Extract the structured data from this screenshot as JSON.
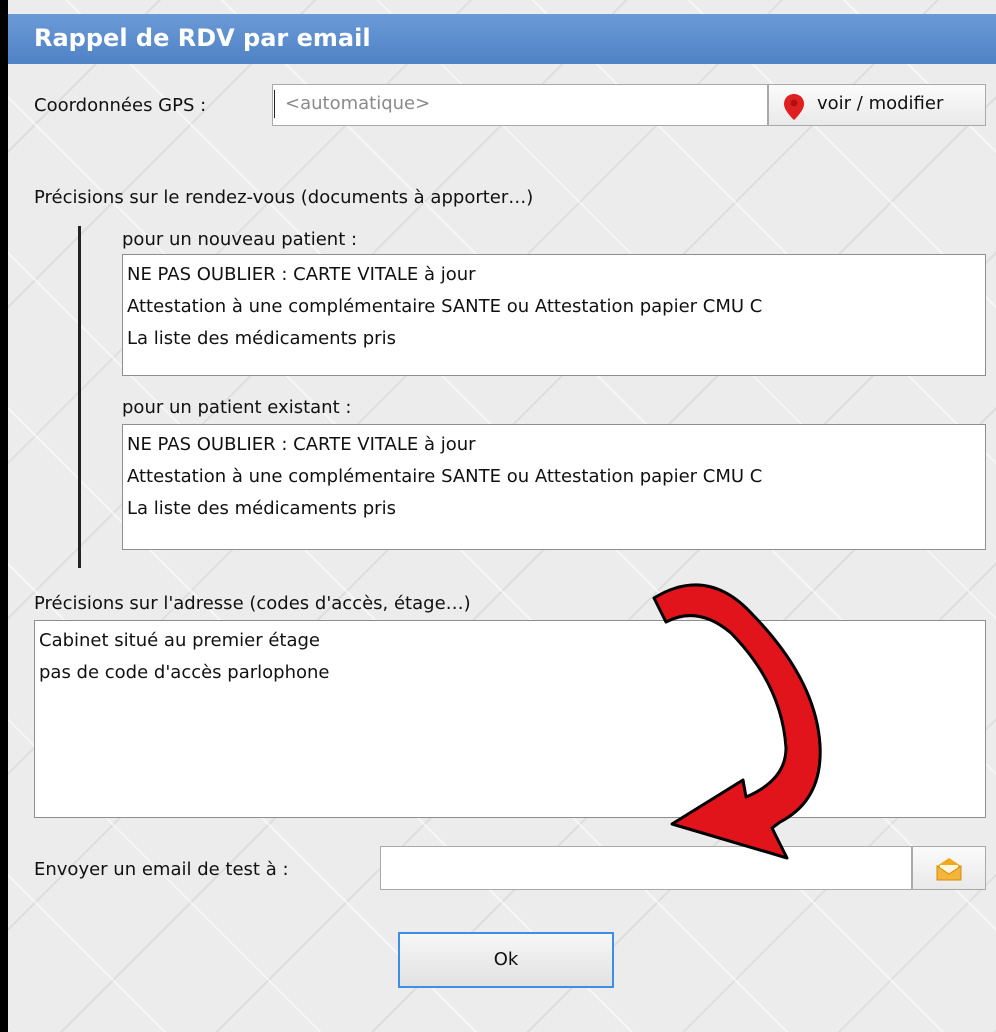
{
  "window": {
    "title": "Rappel de RDV par email"
  },
  "gps": {
    "label": "Coordonnées GPS :",
    "value": "<automatique>",
    "button_label": "voir / modifier"
  },
  "appointment": {
    "heading": "Précisions sur le rendez-vous (documents à apporter…)",
    "new_patient": {
      "label": "pour un nouveau patient :",
      "lines": [
        "NE PAS OUBLIER : CARTE VITALE à jour",
        "Attestation à une complémentaire SANTE ou Attestation papier CMU C",
        "La liste des médicaments pris"
      ]
    },
    "existing_patient": {
      "label": "pour un patient existant :",
      "lines": [
        "NE PAS OUBLIER : CARTE VITALE à jour",
        "Attestation à une complémentaire SANTE ou Attestation papier CMU C",
        "La liste des médicaments pris"
      ]
    }
  },
  "address": {
    "heading": "Précisions sur l'adresse (codes d'accès, étage…)",
    "lines": [
      "Cabinet situé au premier étage",
      "pas de code d'accès parlophone"
    ]
  },
  "test_email": {
    "label": "Envoyer un email de test à :",
    "value": ""
  },
  "ok_button": {
    "label": "Ok"
  },
  "icons": {
    "pin": "map-pin-icon",
    "mail": "mail-envelope-icon",
    "arrow": "red-curved-arrow-annotation"
  },
  "colors": {
    "titlebar": "#5a8dd0",
    "pin": "#e02020",
    "mail": "#f2a81d",
    "arrow": "#e0141a",
    "ok_border": "#3d8ee8"
  }
}
